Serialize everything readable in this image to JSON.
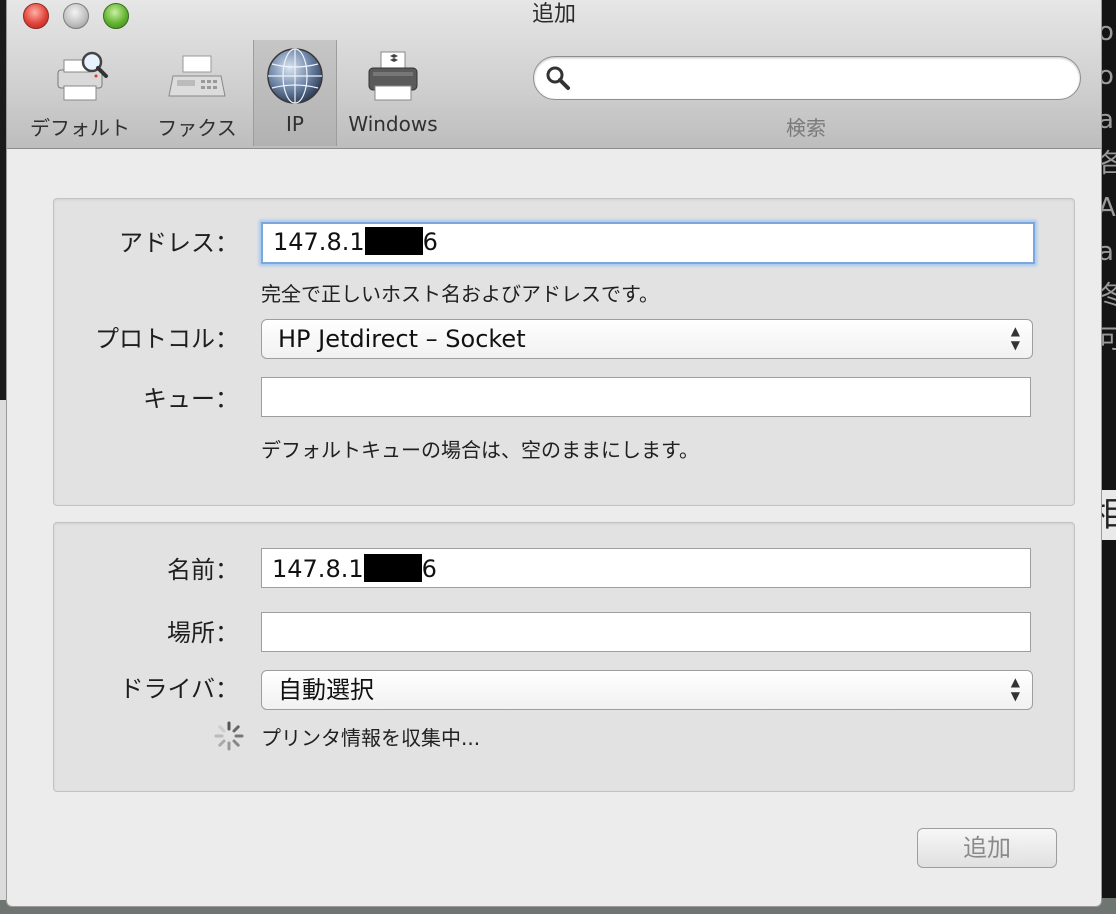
{
  "window": {
    "title": "追加"
  },
  "toolbar": {
    "items": [
      {
        "label": "デフォルト",
        "icon": "printer-search-icon"
      },
      {
        "label": "ファクス",
        "icon": "fax-icon"
      },
      {
        "label": "IP",
        "icon": "globe-icon",
        "selected": true
      },
      {
        "label": "Windows",
        "icon": "windows-printer-icon"
      }
    ],
    "search": {
      "value": "",
      "placeholder": "",
      "label": "検索"
    }
  },
  "connection": {
    "address_label": "アドレス：",
    "address_value_prefix": "147.8.1",
    "address_value_suffix": "6",
    "address_hint": "完全で正しいホスト名およびアドレスです。",
    "protocol_label": "プロトコル：",
    "protocol_value": "HP Jetdirect – Socket",
    "queue_label": "キュー：",
    "queue_value": "",
    "queue_hint": "デフォルトキューの場合は、空のままにします。"
  },
  "printer": {
    "name_label": "名前：",
    "name_value_prefix": "147.8.1",
    "name_value_suffix": "6",
    "location_label": "場所：",
    "location_value": "",
    "driver_label": "ドライバ：",
    "driver_value": "自動選択",
    "status": "プリンタ情報を収集中..."
  },
  "actions": {
    "add_label": "追加"
  },
  "background": {
    "right_glyphs": [
      "o",
      "o",
      "a",
      "各",
      "A",
      "a",
      "冬",
      "可"
    ],
    "right_bar_glyph": "相"
  },
  "colors": {
    "focus": "#7aa8de",
    "window": "#ececec"
  }
}
